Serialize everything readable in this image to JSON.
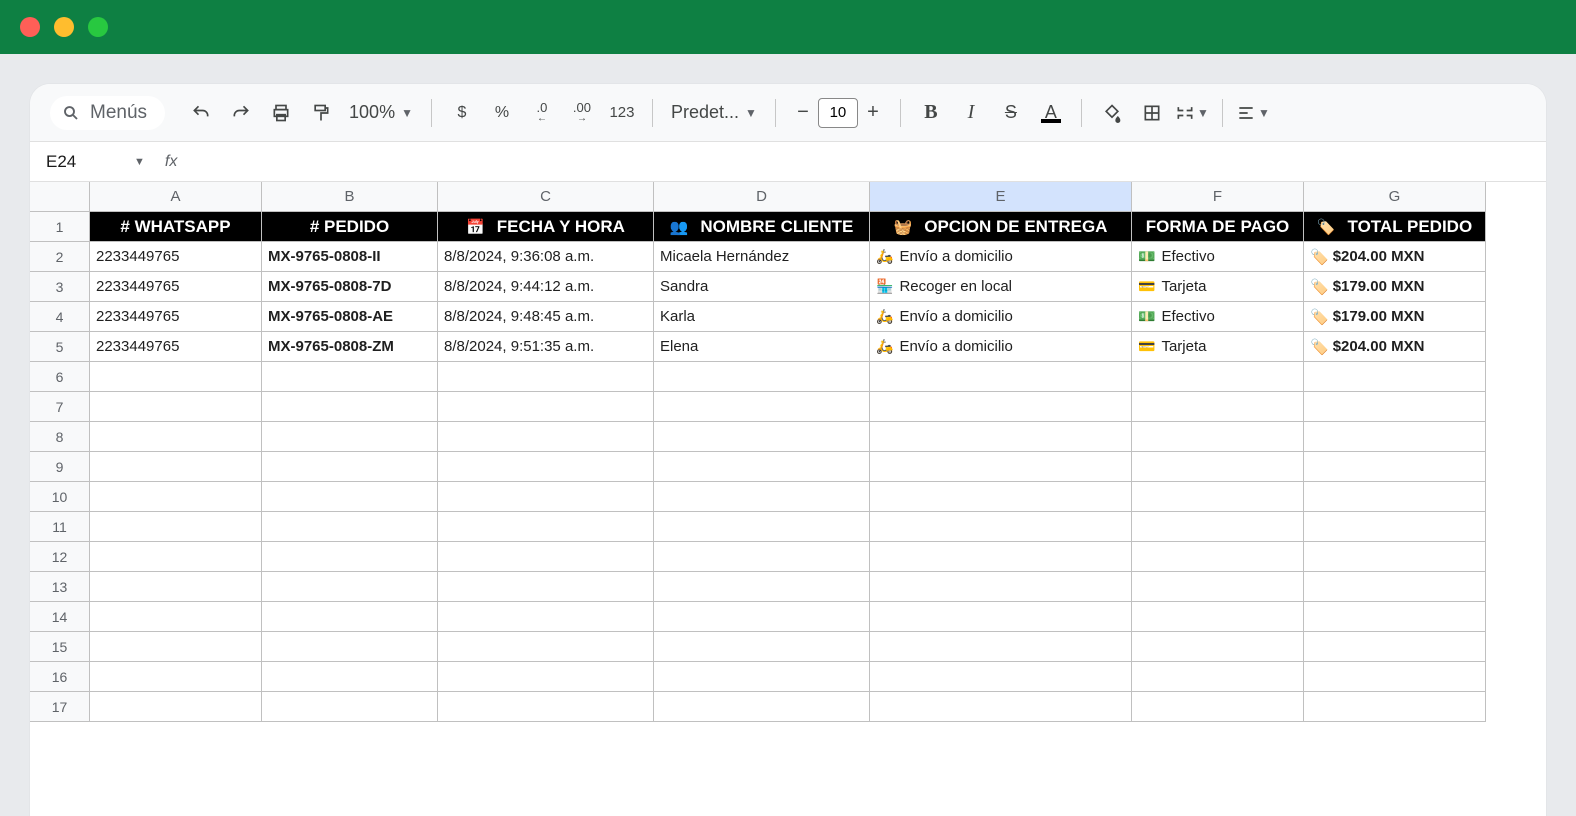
{
  "toolbar": {
    "menus_label": "Menús",
    "zoom": "100%",
    "font": "Predet...",
    "font_size": "10",
    "currency": "$",
    "percent": "%",
    "dec_down": ".0",
    "dec_up": ".00",
    "numfmt": "123"
  },
  "namebox": {
    "cell_ref": "E24",
    "fx": "fx",
    "formula": ""
  },
  "columns": [
    "A",
    "B",
    "C",
    "D",
    "E",
    "F",
    "G"
  ],
  "selected_col": "E",
  "row_numbers": [
    1,
    2,
    3,
    4,
    5,
    6,
    7,
    8,
    9,
    10,
    11,
    12,
    13,
    14,
    15,
    16,
    17
  ],
  "headers": {
    "whatsapp": "# WHATSAPP",
    "pedido": "# PEDIDO",
    "fecha": "FECHA Y HORA",
    "fecha_icon": "📅",
    "nombre": "NOMBRE CLIENTE",
    "nombre_icon": "👥",
    "entrega": "OPCION DE ENTREGA",
    "entrega_icon": "🧺",
    "pago": "FORMA DE PAGO",
    "total": "TOTAL PEDIDO",
    "total_icon": "🏷️"
  },
  "rows": [
    {
      "whatsapp": "2233449765",
      "pedido": "MX-9765-0808-II",
      "fecha": "8/8/2024, 9:36:08 a.m.",
      "nombre": "Micaela Hernández",
      "entrega_icon": "🛵",
      "entrega": "Envío a domicilio",
      "pago_icon": "💵",
      "pago": "Efectivo",
      "total": "$204.00 MXN"
    },
    {
      "whatsapp": "2233449765",
      "pedido": "MX-9765-0808-7D",
      "fecha": "8/8/2024, 9:44:12 a.m.",
      "nombre": "Sandra",
      "entrega_icon": "🏪",
      "entrega": "Recoger en local",
      "pago_icon": "💳",
      "pago": "Tarjeta",
      "total": "$179.00 MXN"
    },
    {
      "whatsapp": "2233449765",
      "pedido": "MX-9765-0808-AE",
      "fecha": "8/8/2024, 9:48:45 a.m.",
      "nombre": "Karla",
      "entrega_icon": "🛵",
      "entrega": "Envío a domicilio",
      "pago_icon": "💵",
      "pago": "Efectivo",
      "total": "$179.00 MXN"
    },
    {
      "whatsapp": "2233449765",
      "pedido": "MX-9765-0808-ZM",
      "fecha": "8/8/2024, 9:51:35 a.m.",
      "nombre": "Elena",
      "entrega_icon": "🛵",
      "entrega": "Envío a domicilio",
      "pago_icon": "💳",
      "pago": "Tarjeta",
      "total": "$204.00 MXN"
    }
  ]
}
